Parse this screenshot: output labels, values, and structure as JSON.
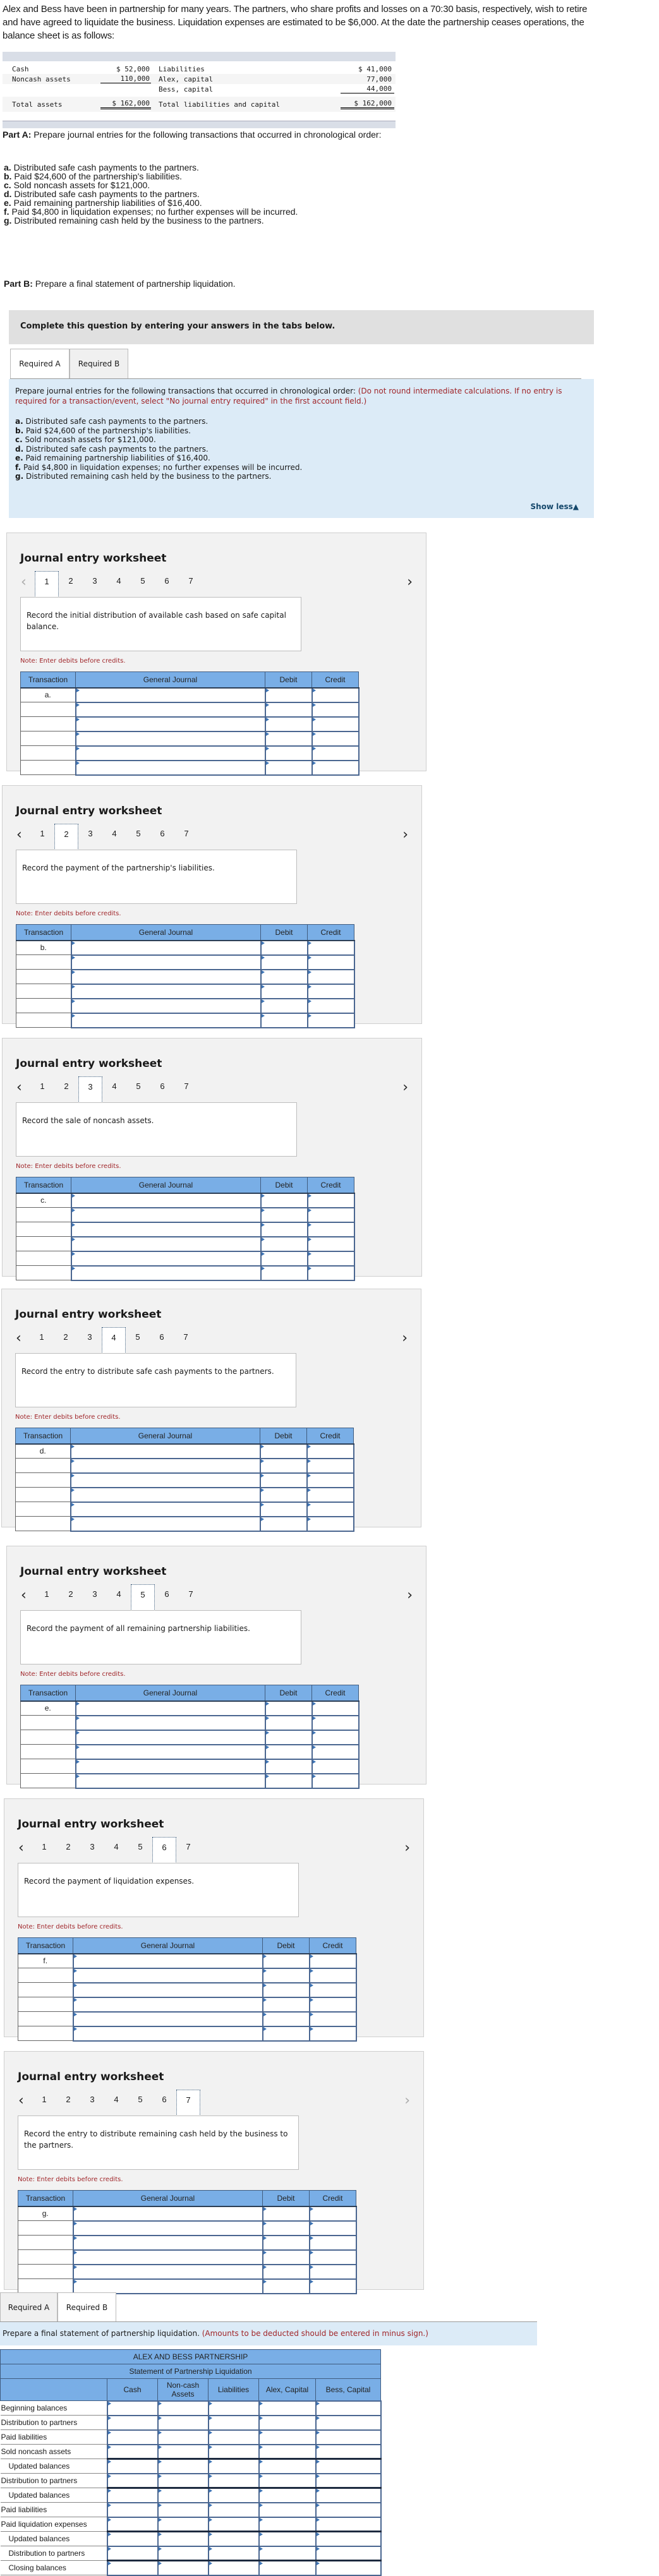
{
  "problem": {
    "intro": "Alex and Bess have been in partnership for many years. The partners, who share profits and losses on a 70:30 basis, respectively, wish to retire and have agreed to liquidate the business. Liquidation expenses are estimated to be $6,000. At the date the partnership ceases operations, the balance sheet is as follows:",
    "balance_sheet": {
      "rows": [
        {
          "asset": "Cash",
          "asset_amt": "$ 52,000",
          "claim": "Liabilities",
          "claim_amt": "$ 41,000"
        },
        {
          "asset": "Noncash assets",
          "asset_amt": "110,000",
          "claim": "Alex, capital",
          "claim_amt": "77,000"
        },
        {
          "asset": "",
          "asset_amt": "",
          "claim": "Bess, capital",
          "claim_amt": "44,000"
        }
      ],
      "total": {
        "asset": "Total assets",
        "asset_amt": "$ 162,000",
        "claim": "Total liabilities and capital",
        "claim_amt": "$ 162,000"
      }
    },
    "part_a_label": "Part A:",
    "part_a_text": " Prepare journal entries for the following transactions that occurred in chronological order:",
    "transactions": [
      {
        "letter": "a.",
        "text": " Distributed safe cash payments to the partners."
      },
      {
        "letter": "b.",
        "text": " Paid $24,600 of the partnership's liabilities."
      },
      {
        "letter": "c.",
        "text": " Sold noncash assets for $121,000."
      },
      {
        "letter": "d.",
        "text": " Distributed safe cash payments to the partners."
      },
      {
        "letter": "e.",
        "text": " Paid remaining partnership liabilities of $16,400."
      },
      {
        "letter": "f.",
        "text": " Paid $4,800 in liquidation expenses; no further expenses will be incurred."
      },
      {
        "letter": "g.",
        "text": " Distributed remaining cash held by the business to the partners."
      }
    ],
    "part_b_label": "Part B:",
    "part_b_text": " Prepare a final statement of partnership liquidation."
  },
  "complete_banner": "Complete this question by entering your answers in the tabs below.",
  "tabs": [
    "Required A",
    "Required B"
  ],
  "required_a": {
    "instruction": "Prepare journal entries for the following transactions that occurred in chronological order: ",
    "instruction_note": "(Do not round intermediate calculations. If no entry is required for a transaction/event, select \"No journal entry required\" in the first account field.)",
    "transactions": [
      {
        "letter": "a.",
        "text": " Distributed safe cash payments to the partners."
      },
      {
        "letter": "b.",
        "text": " Paid $24,600 of the partnership's liabilities."
      },
      {
        "letter": "c.",
        "text": " Sold noncash assets for $121,000."
      },
      {
        "letter": "d.",
        "text": " Distributed safe cash payments to the partners."
      },
      {
        "letter": "e.",
        "text": " Paid remaining partnership liabilities of $16,400."
      },
      {
        "letter": "f.",
        "text": " Paid $4,800 in liquidation expenses; no further expenses will be incurred."
      },
      {
        "letter": "g.",
        "text": " Distributed remaining cash held by the business to the partners."
      }
    ],
    "show_less": "Show less▲"
  },
  "worksheet": {
    "title": "Journal entry worksheet",
    "prev_icon": "‹",
    "next_icon": "›",
    "numbers": [
      "1",
      "2",
      "3",
      "4",
      "5",
      "6",
      "7"
    ],
    "note": "Note: Enter debits before credits.",
    "headers": [
      "Transaction",
      "General Journal",
      "Debit",
      "Credit"
    ],
    "entries": [
      {
        "active": "1",
        "desc": "Record the initial distribution of available cash based on safe capital balance.",
        "transaction": "a."
      },
      {
        "active": "2",
        "desc": "Record the payment of the partnership's liabilities.",
        "transaction": "b."
      },
      {
        "active": "3",
        "desc": "Record the sale of noncash assets.",
        "transaction": "c."
      },
      {
        "active": "4",
        "desc": "Record the entry to distribute safe cash payments to the partners.",
        "transaction": "d."
      },
      {
        "active": "5",
        "desc": "Record the payment of all remaining partnership liabilities.",
        "transaction": "e."
      },
      {
        "active": "6",
        "desc": "Record the payment of liquidation expenses.",
        "transaction": "f."
      },
      {
        "active": "7",
        "desc": "Record the entry to distribute remaining cash held by the business to the partners.",
        "transaction": "g."
      }
    ]
  },
  "required_b": {
    "instruction": "Prepare a final statement of partnership liquidation. ",
    "instruction_note": "(Amounts to be deducted should be entered in minus sign.)",
    "statement_title": "ALEX AND BESS PARTNERSHIP",
    "statement_subtitle": "Statement of Partnership Liquidation",
    "columns": [
      "Cash",
      "Non-cash Assets",
      "Liabilities",
      "Alex, Capital",
      "Bess, Capital"
    ],
    "rows": [
      {
        "label": "Beginning balances",
        "indent": false,
        "total": false
      },
      {
        "label": "Distribution to partners",
        "indent": false,
        "total": false
      },
      {
        "label": "Paid liabilities",
        "indent": false,
        "total": false
      },
      {
        "label": "Sold noncash assets",
        "indent": false,
        "total": false
      },
      {
        "label": "Updated balances",
        "indent": true,
        "total": true
      },
      {
        "label": "Distribution to partners",
        "indent": false,
        "total": false
      },
      {
        "label": "Updated balances",
        "indent": true,
        "total": true
      },
      {
        "label": "Paid liabilities",
        "indent": false,
        "total": false
      },
      {
        "label": "Paid liquidation expenses",
        "indent": false,
        "total": false
      },
      {
        "label": "Updated balances",
        "indent": true,
        "total": true
      },
      {
        "label": "Distribution to partners",
        "indent": true,
        "total": false
      },
      {
        "label": "Closing balances",
        "indent": true,
        "total": true
      }
    ]
  }
}
